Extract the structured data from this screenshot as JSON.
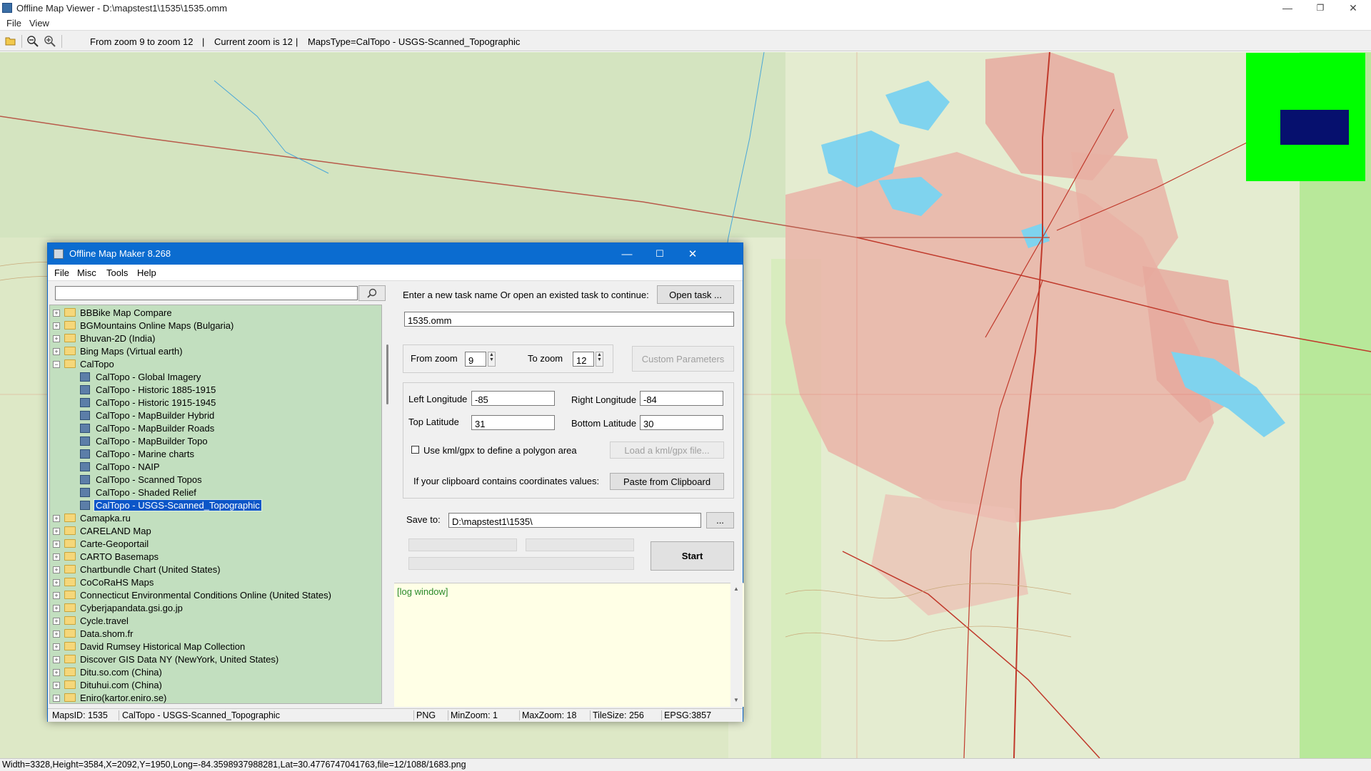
{
  "window": {
    "title": "Offline Map Viewer - D:\\mapstest1\\1535\\1535.omm",
    "minimize_icon": "minimize-icon",
    "restore_icon": "restore-icon",
    "close_icon": "close-icon"
  },
  "menubar": {
    "file": "File",
    "view": "View"
  },
  "toolbar": {
    "icons": [
      "open-folder-icon",
      "zoom-out-icon",
      "zoom-in-icon"
    ],
    "zoom_range": "From zoom 9 to zoom 12",
    "sep1": "|",
    "current_zoom": "Current zoom is 12",
    "sep2": "|",
    "maps_type": "MapsType=CalTopo - USGS-Scanned_Topographic"
  },
  "statusbar": {
    "text": "Width=3328,Height=3584,X=2092,Y=1950,Long=-84.3598937988281,Lat=30.4776747041763,file=12/1088/1683.png"
  },
  "minimap": {
    "background": "#00ff00",
    "view_color": "#06106e"
  },
  "dialog": {
    "title": "Offline Map Maker 8.268",
    "menu": {
      "file": "File",
      "misc": "Misc",
      "tools": "Tools",
      "help": "Help"
    },
    "search": {
      "value": "",
      "button_icon": "search-icon"
    },
    "tree": [
      {
        "label": "BBBike Map Compare",
        "level": 0,
        "type": "folder"
      },
      {
        "label": "BGMountains Online Maps (Bulgaria)",
        "level": 0,
        "type": "folder"
      },
      {
        "label": "Bhuvan-2D (India)",
        "level": 0,
        "type": "folder"
      },
      {
        "label": "Bing Maps (Virtual earth)",
        "level": 0,
        "type": "folder"
      },
      {
        "label": "CalTopo",
        "level": 0,
        "type": "folder",
        "expanded": true
      },
      {
        "label": "CalTopo - Global Imagery",
        "level": 1,
        "type": "map"
      },
      {
        "label": "CalTopo - Historic 1885-1915",
        "level": 1,
        "type": "map"
      },
      {
        "label": "CalTopo - Historic 1915-1945",
        "level": 1,
        "type": "map"
      },
      {
        "label": "CalTopo - MapBuilder Hybrid",
        "level": 1,
        "type": "map"
      },
      {
        "label": "CalTopo - MapBuilder Roads",
        "level": 1,
        "type": "map"
      },
      {
        "label": "CalTopo - MapBuilder Topo",
        "level": 1,
        "type": "map"
      },
      {
        "label": "CalTopo - Marine charts",
        "level": 1,
        "type": "map"
      },
      {
        "label": "CalTopo - NAIP",
        "level": 1,
        "type": "map"
      },
      {
        "label": "CalTopo - Scanned Topos",
        "level": 1,
        "type": "map"
      },
      {
        "label": "CalTopo - Shaded Relief",
        "level": 1,
        "type": "map"
      },
      {
        "label": "CalTopo - USGS-Scanned_Topographic",
        "level": 1,
        "type": "map",
        "selected": true
      },
      {
        "label": "Camapka.ru",
        "level": 0,
        "type": "folder"
      },
      {
        "label": "CARELAND Map",
        "level": 0,
        "type": "folder"
      },
      {
        "label": "Carte-Geoportail",
        "level": 0,
        "type": "folder"
      },
      {
        "label": "CARTO Basemaps",
        "level": 0,
        "type": "folder"
      },
      {
        "label": "Chartbundle Chart (United States)",
        "level": 0,
        "type": "folder"
      },
      {
        "label": "CoCoRaHS Maps",
        "level": 0,
        "type": "folder"
      },
      {
        "label": "Connecticut Environmental Conditions Online (United States)",
        "level": 0,
        "type": "folder"
      },
      {
        "label": "Cyberjapandata.gsi.go.jp",
        "level": 0,
        "type": "folder"
      },
      {
        "label": "Cycle.travel",
        "level": 0,
        "type": "folder"
      },
      {
        "label": "Data.shom.fr",
        "level": 0,
        "type": "folder"
      },
      {
        "label": "David Rumsey Historical Map Collection",
        "level": 0,
        "type": "folder"
      },
      {
        "label": "Discover GIS Data NY (NewYork, United States)",
        "level": 0,
        "type": "folder"
      },
      {
        "label": "Ditu.so.com (China)",
        "level": 0,
        "type": "folder"
      },
      {
        "label": "Dituhui.com (China)",
        "level": 0,
        "type": "folder"
      },
      {
        "label": "Eniro(kartor.eniro.se)",
        "level": 0,
        "type": "folder"
      }
    ],
    "task": {
      "prompt": "Enter a new task name Or open an existed task to continue:",
      "open_button": "Open task ...",
      "name_value": "1535.omm"
    },
    "zoom": {
      "from_label": "From zoom",
      "from_value": "9",
      "to_label": "To zoom",
      "to_value": "12",
      "custom_button": "Custom Parameters"
    },
    "coords": {
      "left_lon_label": "Left Longitude",
      "left_lon_value": "-85",
      "right_lon_label": "Right Longitude",
      "right_lon_value": "-84",
      "top_lat_label": "Top Latitude",
      "top_lat_value": "31",
      "bottom_lat_label": "Bottom Latitude",
      "bottom_lat_value": "30",
      "kml_checkbox_label": "Use kml/gpx to define a polygon area",
      "kml_checked": false,
      "load_kml_button": "Load a kml/gpx file...",
      "clipboard_label": "If your clipboard contains coordinates values:",
      "paste_button": "Paste from Clipboard"
    },
    "save": {
      "label": "Save to:",
      "path": "D:\\mapstest1\\1535\\",
      "browse_button": "...",
      "start_button": "Start"
    },
    "log": {
      "text": "[log window]"
    },
    "status": {
      "maps_id": "MapsID: 1535",
      "map_name": "CalTopo - USGS-Scanned_Topographic",
      "format": "PNG",
      "min_zoom": "MinZoom: 1",
      "max_zoom": "MaxZoom: 18",
      "tile_size": "TileSize: 256",
      "epsg": "EPSG:3857"
    }
  }
}
